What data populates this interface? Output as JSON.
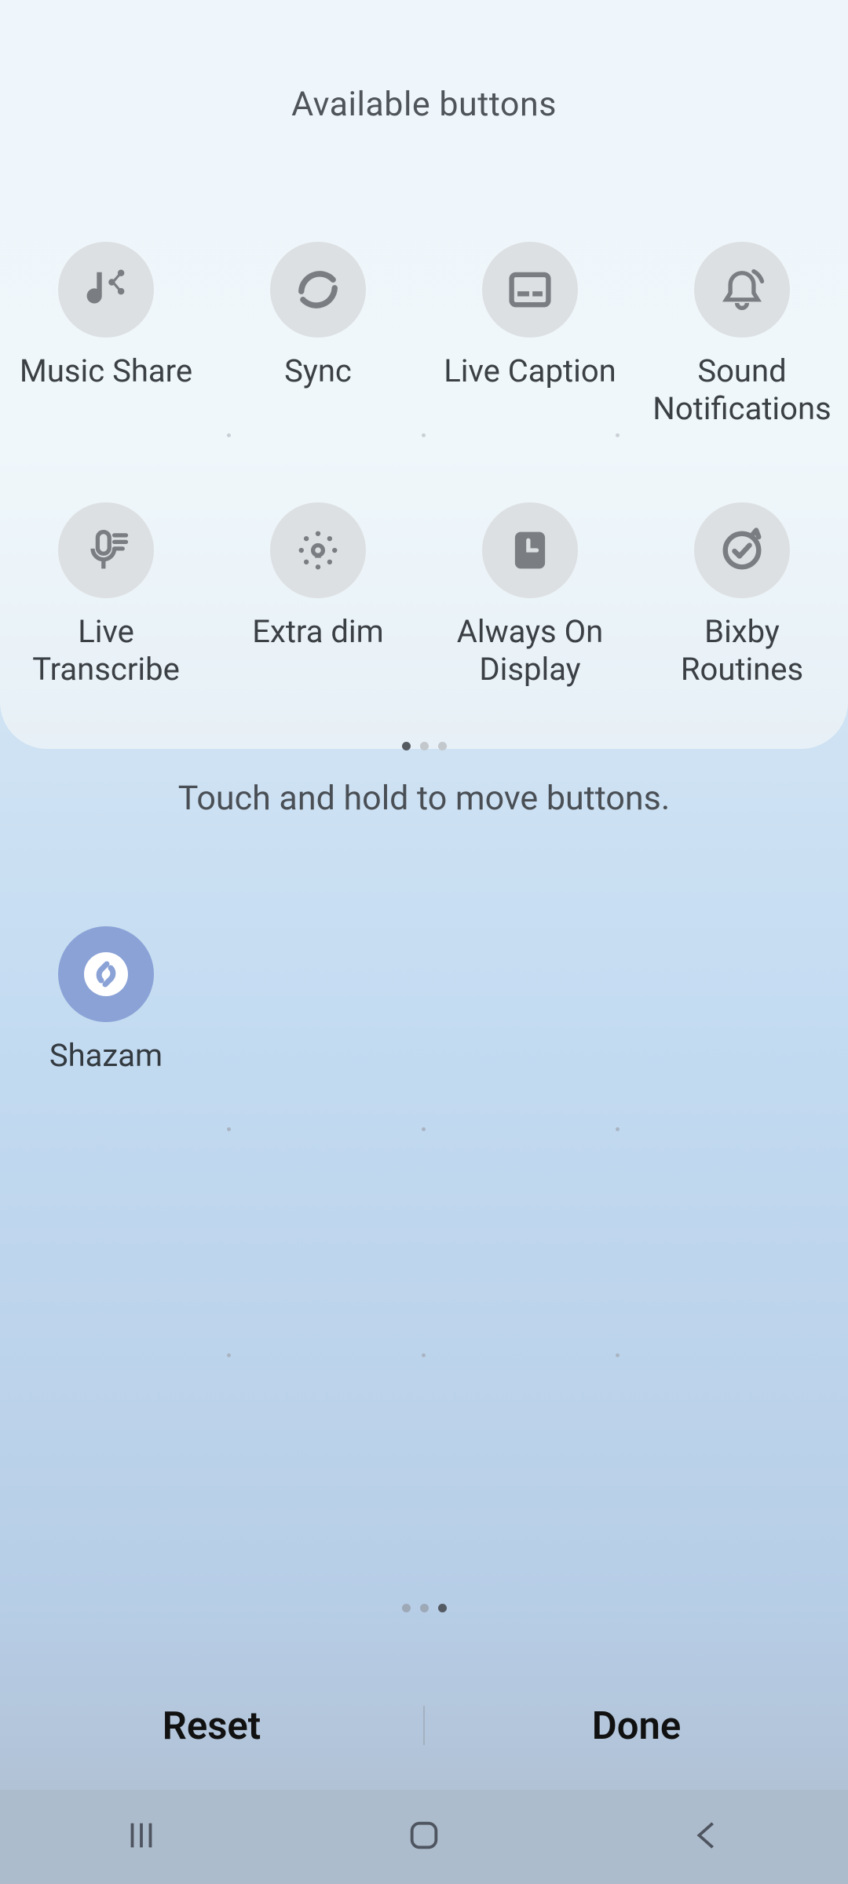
{
  "panel": {
    "title": "Available buttons",
    "items": [
      {
        "label": "Music Share"
      },
      {
        "label": "Sync"
      },
      {
        "label": "Live Caption"
      },
      {
        "label": "Sound\nNotifications"
      },
      {
        "label": "Live\nTranscribe"
      },
      {
        "label": "Extra dim"
      },
      {
        "label": "Always On\nDisplay"
      },
      {
        "label": "Bixby\nRoutines"
      }
    ],
    "page_index": 0,
    "page_count": 3
  },
  "hint": "Touch and hold to move buttons.",
  "placed": {
    "items": [
      {
        "label": "Shazam"
      }
    ],
    "page_index": 2,
    "page_count": 3
  },
  "footer": {
    "reset": "Reset",
    "done": "Done"
  }
}
